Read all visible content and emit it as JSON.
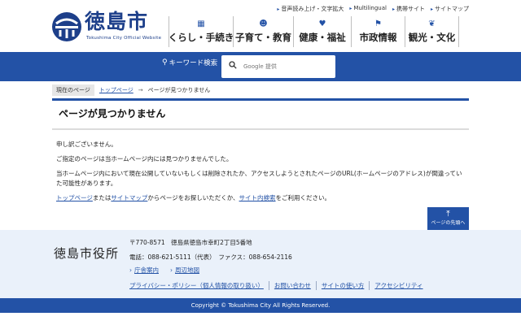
{
  "site": {
    "logo_text": "徳島市",
    "logo_sub": "Tokushima City Official Website"
  },
  "utility_links": [
    {
      "label": "音声読み上げ・文字拡大"
    },
    {
      "label": "Multilingual"
    },
    {
      "label": "携帯サイト"
    },
    {
      "label": "サイトマップ"
    }
  ],
  "global_nav": [
    {
      "label": "くらし・手続き",
      "icon": "building-icon"
    },
    {
      "label": "子育て・教育",
      "icon": "family-icon"
    },
    {
      "label": "健康・福祉",
      "icon": "heart-icon"
    },
    {
      "label": "市政情報",
      "icon": "flag-icon"
    },
    {
      "label": "観光・文化",
      "icon": "leaf-icon"
    }
  ],
  "search": {
    "label": "キーワード検索",
    "placeholder": "Google 提供"
  },
  "breadcrumb": {
    "current_label": "現在のページ",
    "top_link": "トップページ",
    "separator": "→",
    "here": "ページが見つかりません"
  },
  "main": {
    "title": "ページが見つかりません",
    "p1": "申し訳ございません。",
    "p2": "ご指定のページは当ホームページ内には見つかりませんでした。",
    "p3": "当ホームページ内において現在公開していないもしくは削除されたか、アクセスしようとされたページのURL(ホームページのアドレス)が間違っていた可能性があります。",
    "p4": {
      "link1": "トップページ",
      "text1": "または",
      "link2": "サイトマップ",
      "text2": "からページをお探しいただくか、",
      "link3": "サイト内検索",
      "text3": "をご利用ください。"
    }
  },
  "pagetop": {
    "label": "ページの先頭へ"
  },
  "footer": {
    "name": "徳島市役所",
    "address": "〒770-8571　徳島県徳島市幸町2丁目5番地",
    "tel": "電話：088-621-5111（代表）　ファクス：088-654-2116",
    "links1": [
      {
        "label": "庁舎案内"
      },
      {
        "label": "周辺地図"
      }
    ],
    "links2": [
      {
        "label": "プライバシー・ポリシー（個人情報の取り扱い）"
      },
      {
        "label": "お問い合わせ"
      },
      {
        "label": "サイトの使い方"
      },
      {
        "label": "アクセシビリティ"
      }
    ],
    "copyright": "Copyright © Tokushima City All Rights Reserved."
  },
  "colors": {
    "brand_blue": "#2352a6",
    "logo_navy": "#1d3f8a",
    "footer_bg": "#eaf1fa"
  }
}
